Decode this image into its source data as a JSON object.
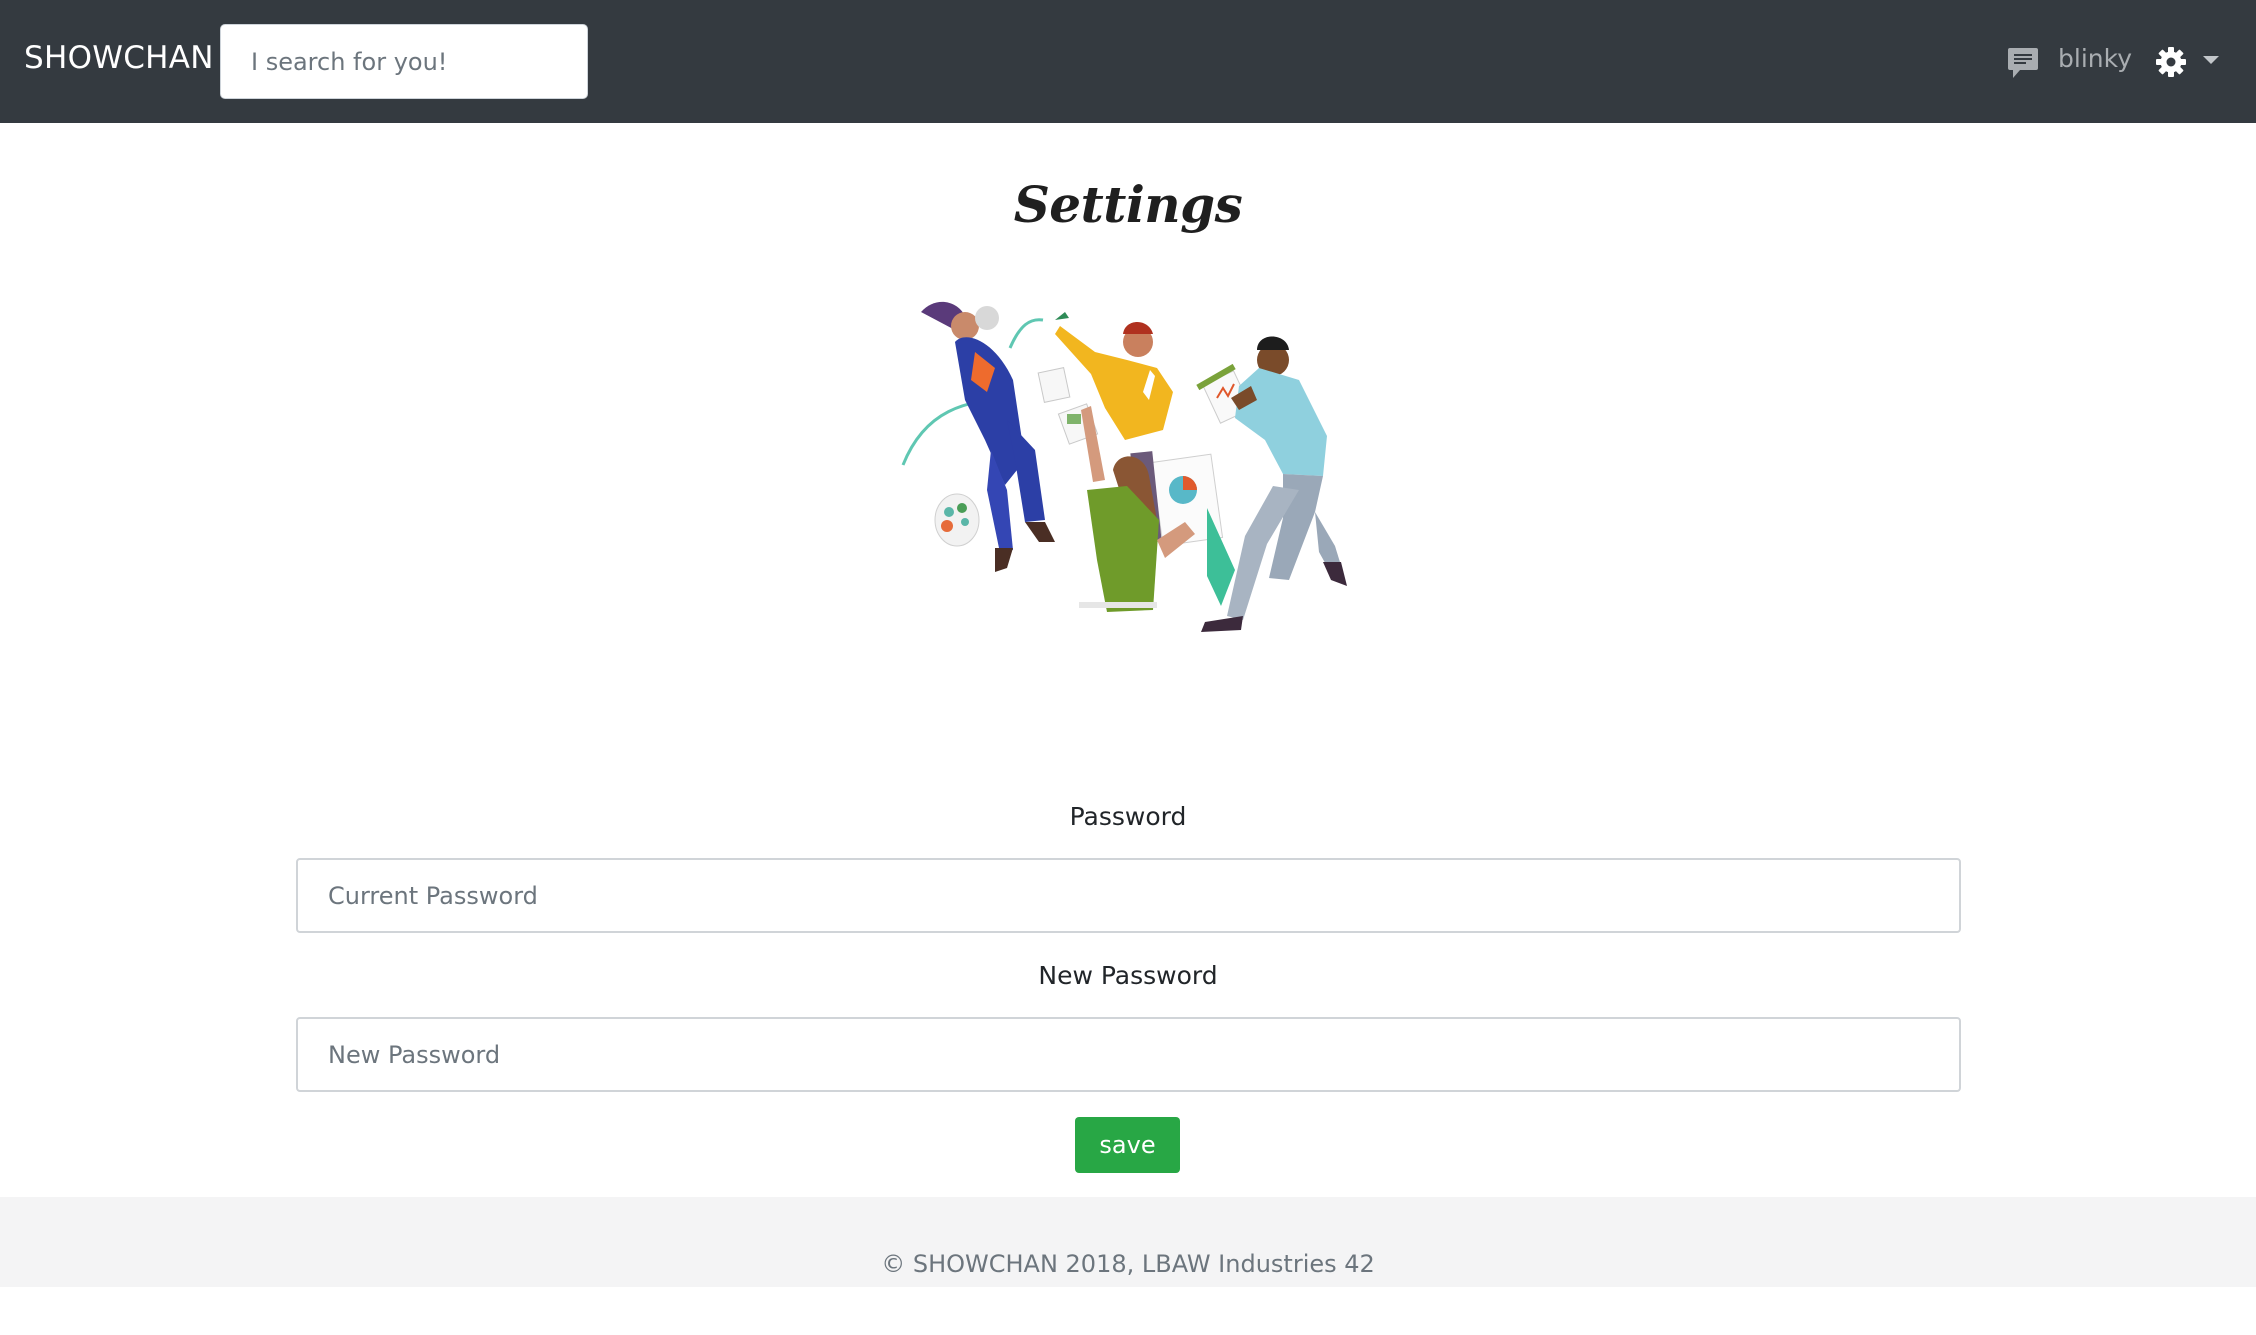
{
  "navbar": {
    "brand": "SHOWCHAN",
    "search_placeholder": "I search for you!",
    "username": "blinky",
    "icons": [
      "chat-icon",
      "gear-icon",
      "caret-down-icon"
    ],
    "background_color": "#343a40"
  },
  "main": {
    "title": "Settings",
    "illustration": "team-illustration",
    "fields": [
      {
        "label": "Password",
        "placeholder": "Current Password"
      },
      {
        "label": "New Password",
        "placeholder": "New Password"
      }
    ],
    "save_label": "save",
    "save_color": "#28a745"
  },
  "footer": {
    "text": "© SHOWCHAN 2018, LBAW Industries 42"
  }
}
